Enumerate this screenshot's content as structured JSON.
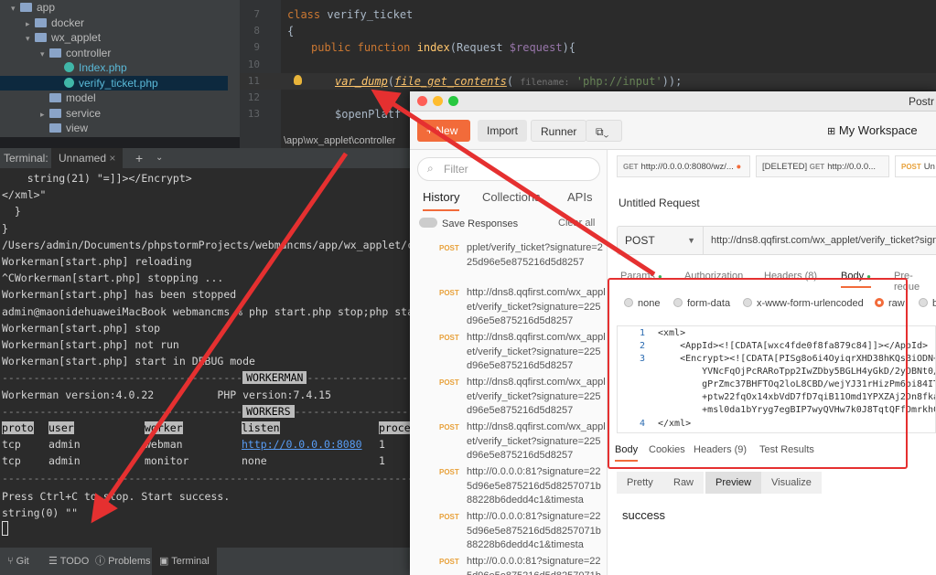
{
  "tree": {
    "items": [
      {
        "label": "app",
        "kind": "folder",
        "indent": 0
      },
      {
        "label": "docker",
        "kind": "folder",
        "indent": 1
      },
      {
        "label": "wx_applet",
        "kind": "folder",
        "indent": 1
      },
      {
        "label": "controller",
        "kind": "folder",
        "indent": 2
      },
      {
        "label": "Index.php",
        "kind": "php",
        "indent": 3
      },
      {
        "label": "verify_ticket.php",
        "kind": "php",
        "indent": 3
      },
      {
        "label": "model",
        "kind": "folder",
        "indent": 2
      },
      {
        "label": "service",
        "kind": "folder",
        "indent": 2
      },
      {
        "label": "view",
        "kind": "folder",
        "indent": 2
      }
    ]
  },
  "editor": {
    "lines": [
      "7",
      "8",
      "9",
      "10",
      "11",
      "12",
      "13"
    ],
    "class_kw": "class",
    "class_name": "verify_ticket",
    "brace": "{",
    "public_kw": "public",
    "function_kw": "function",
    "fn_name": "index",
    "fn_args_a": "(Request ",
    "fn_arg_var": "$request",
    "fn_args_b": "){",
    "vd_fn": "var_dump",
    "vd_open": "(",
    "fgc_fn": "file_get_contents",
    "fgc_open": "(",
    "hint": "filename:",
    "arg": "'php://input'",
    "close": "));",
    "line13": "$openPlatf",
    "breadcrumb": "\\app\\wx_applet\\controller"
  },
  "terminal": {
    "title": "Terminal:",
    "tab": "Unnamed",
    "lines": [
      "    string(21) \"=]]></Encrypt>",
      "</xml>\"",
      "  }",
      "}",
      "/Users/admin/Documents/phpstormProjects/webmancms/app/wx_applet/cont",
      "Workerman[start.php] reloading",
      "^CWorkerman[start.php] stopping ...",
      "Workerman[start.php] has been stopped",
      "admin@maonidehuaweiMacBook webmancms % php start.php stop;php start.",
      "Workerman[start.php] stop",
      "Workerman[start.php] not run",
      "Workerman[start.php] start in DEBUG mode"
    ],
    "workerman_label": "WORKERMAN",
    "version_line": "Workerman version:4.0.22          PHP version:7.4.15",
    "workers_label": "WORKERS",
    "headers": [
      "proto",
      "user",
      "worker",
      "listen",
      "proce"
    ],
    "rows": [
      [
        "tcp",
        "admin",
        "webman",
        "http://0.0.0.0:8080",
        "1"
      ],
      [
        "tcp",
        "admin",
        "monitor",
        "none",
        "1"
      ]
    ],
    "press_line": "Press Ctrl+C to stop. Start success.",
    "output_line": "string(0) \"\""
  },
  "toolwindows": [
    "Git",
    "TODO",
    "Problems",
    "Terminal"
  ],
  "postman": {
    "app_title": "Postr",
    "toolbar": {
      "new": "New",
      "import": "Import",
      "runner": "Runner",
      "workspace": "My Workspace"
    },
    "filter_placeholder": "Filter",
    "sidebar_tabs": [
      "History",
      "Collections",
      "APIs"
    ],
    "save_responses": "Save Responses",
    "clear_all": "Clear all",
    "history": [
      {
        "method": "POST",
        "text": "pplet/verify_ticket?signature=225d96e5e875216d5d8257"
      },
      {
        "method": "POST",
        "text": "http://dns8.qqfirst.com/wx_applet/verify_ticket?signature=225d96e5e875216d5d8257"
      },
      {
        "method": "POST",
        "text": "http://dns8.qqfirst.com/wx_applet/verify_ticket?signature=225d96e5e875216d5d8257"
      },
      {
        "method": "POST",
        "text": "http://dns8.qqfirst.com/wx_applet/verify_ticket?signature=225d96e5e875216d5d8257"
      },
      {
        "method": "POST",
        "text": "http://dns8.qqfirst.com/wx_applet/verify_ticket?signature=225d96e5e875216d5d8257"
      },
      {
        "method": "POST",
        "text": "http://0.0.0.0:81?signature=225d96e5e875216d5d8257071b88228b6dedd4c1&timesta"
      },
      {
        "method": "POST",
        "text": "http://0.0.0.0:81?signature=225d96e5e875216d5d8257071b88228b6dedd4c1&timesta"
      },
      {
        "method": "POST",
        "text": "http://0.0.0.0:81?signature=225d96e5e875216d5d8257071b88228b6dedd4c1&timesta"
      }
    ],
    "req_tabs": [
      {
        "method": "GET",
        "label": "http://0.0.0.0:8080/wz/..."
      },
      {
        "method": "GET",
        "label": "http://0.0.0...",
        "prefix": "[DELETED]"
      },
      {
        "method": "POST",
        "label": "Un"
      }
    ],
    "request_name": "Untitled Request",
    "method": "POST",
    "url": "http://dns8.qqfirst.com/wx_applet/verify_ticket?signat",
    "param_tabs": [
      "Params",
      "Authorization",
      "Headers (8)",
      "Body",
      "Pre-reque"
    ],
    "body_types": [
      "none",
      "form-data",
      "x-www-form-urlencoded",
      "raw",
      "b"
    ],
    "code_nums": [
      "1",
      "2",
      "3",
      "",
      "",
      "",
      "",
      "4"
    ],
    "code_lines": [
      "<xml>",
      "    <AppId><![CDATA[wxc4fde0f8fa879c84]]></AppId>",
      "    <Encrypt><![CDATA[PISg8o6i4OyiqrXHD38hKQsBiODN+",
      "        YVNcFqOjPcRARoTpp2IwZDby5BGLH4yGkD/2yOBNt0/",
      "        gPrZmc37BHFTOq2loL8CBD/wejYJ31rHizPm6bi84IT",
      "        +ptw22fqOx14xbVdD7fD7qiB11Omd1YPXZAj2Dn8fka",
      "        +msl0da1bYryg7egBIP7wyQVHw7k0J8TqtQFfOmrkhC",
      "</xml>"
    ],
    "resp_tabs": [
      "Body",
      "Cookies",
      "Headers (9)",
      "Test Results"
    ],
    "resp_views": [
      "Pretty",
      "Raw",
      "Preview",
      "Visualize"
    ],
    "response": "success"
  },
  "colors": {
    "accent": "#f26b3a",
    "annotation": "#e53030"
  }
}
